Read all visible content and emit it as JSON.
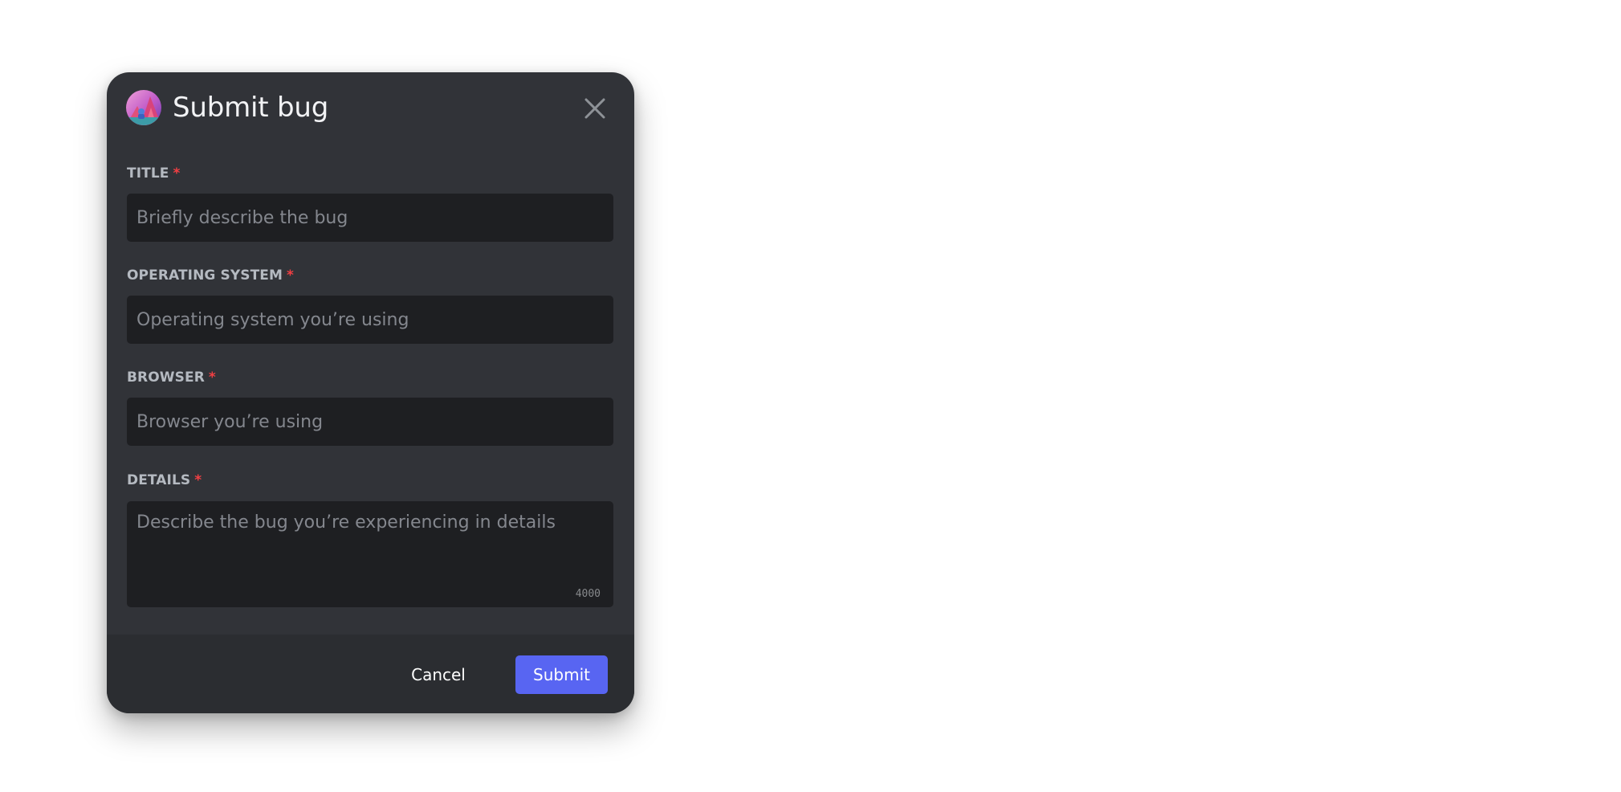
{
  "modal": {
    "title": "Submit bug",
    "app_icon": "app-avatar-icon",
    "close_icon": "close-icon"
  },
  "fields": {
    "title": {
      "label": "TITLE",
      "required_mark": "*",
      "placeholder": "Briefly describe the bug",
      "value": ""
    },
    "os": {
      "label": "OPERATING SYSTEM",
      "required_mark": "*",
      "placeholder": "Operating system you’re using",
      "value": ""
    },
    "browser": {
      "label": "BROWSER",
      "required_mark": "*",
      "placeholder": "Browser you’re using",
      "value": ""
    },
    "details": {
      "label": "DETAILS",
      "required_mark": "*",
      "placeholder": "Describe the bug you’re experiencing in details",
      "value": "",
      "char_counter": "4000"
    }
  },
  "footer": {
    "cancel_label": "Cancel",
    "submit_label": "Submit"
  },
  "colors": {
    "modal_bg": "#313338",
    "footer_bg": "#2b2d31",
    "input_bg": "#1e1f22",
    "label": "#b5bac1",
    "required": "#f23f43",
    "placeholder": "#84878e",
    "accent": "#5865f2"
  }
}
